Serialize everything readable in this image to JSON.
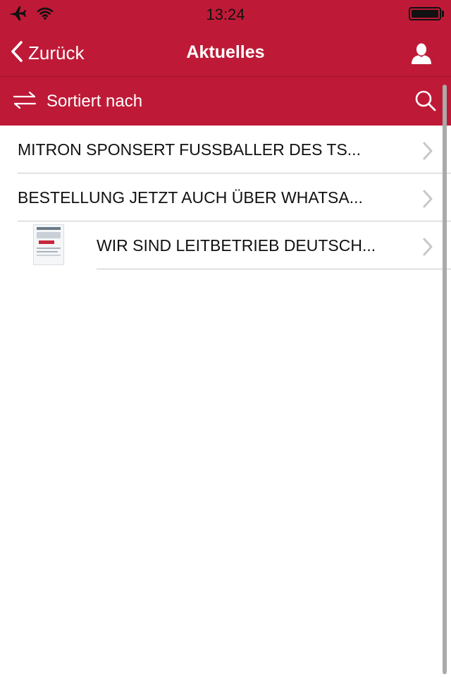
{
  "status_bar": {
    "time": "13:24"
  },
  "nav": {
    "back_label": "Zurück",
    "title": "Aktuelles"
  },
  "sort_bar": {
    "label": "Sortiert nach"
  },
  "colors": {
    "brand_red": "#be1a37",
    "text": "#111111",
    "separator": "#c8c7cc",
    "chevron": "#c7c7cc"
  },
  "news_items": [
    {
      "title": "MITRON SPONSERT FUSSBALLER DES TS...",
      "has_thumbnail": false
    },
    {
      "title": "BESTELLUNG JETZT AUCH ÜBER WHATSA...",
      "has_thumbnail": false
    },
    {
      "title": "WIR SIND LEITBETRIEB DEUTSCH...",
      "has_thumbnail": true
    }
  ]
}
